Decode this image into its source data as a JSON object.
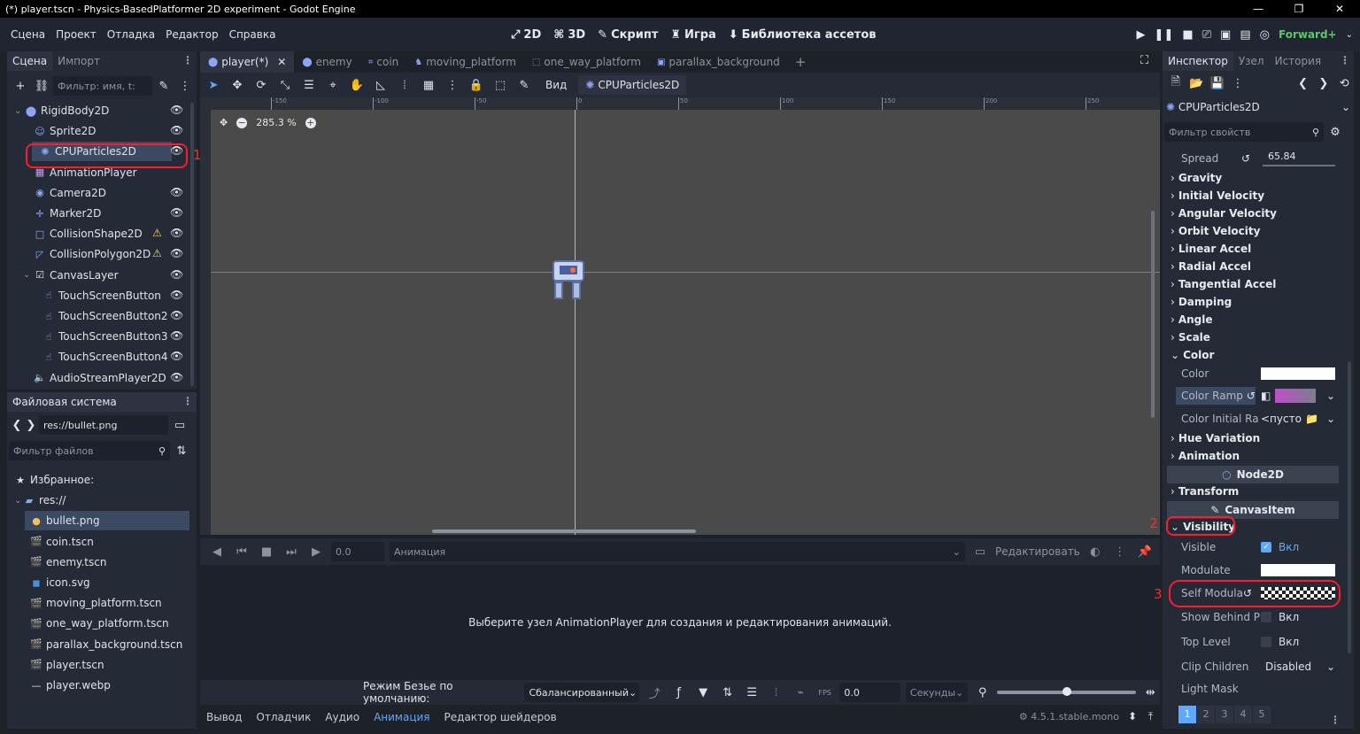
{
  "window": {
    "title": "(*) player.tscn - Physics-BasedPlatformer 2D experiment - Godot Engine",
    "buttons": [
      "—",
      "❐",
      "✕"
    ]
  },
  "menu": [
    "Сцена",
    "Проект",
    "Отладка",
    "Редактор",
    "Справка"
  ],
  "workspaces": [
    {
      "icon": "⤢",
      "label": "2D"
    },
    {
      "icon": "⌘",
      "label": "3D"
    },
    {
      "icon": "✎",
      "label": "Скрипт"
    },
    {
      "icon": "♜",
      "label": "Игра"
    },
    {
      "icon": "⬇",
      "label": "Библиотека ассетов"
    }
  ],
  "renderer": "Forward+",
  "scene_dock": {
    "tabs": [
      "Сцена",
      "Импорт"
    ],
    "filter_placeholder": "Фильтр: имя, t:",
    "nodes": [
      {
        "name": "RigidBody2D",
        "icon": "⬤",
        "color": "#8da5f3",
        "indent": 0,
        "arrow": "⌄"
      },
      {
        "name": "Sprite2D",
        "icon": "☺",
        "color": "#8da5f3",
        "indent": 1,
        "arrow": ""
      },
      {
        "name": "CPUParticles2D",
        "icon": "✺",
        "color": "#8da5f3",
        "indent": 2,
        "arrow": "",
        "selected": true
      },
      {
        "name": "AnimationPlayer",
        "icon": "▦",
        "color": "#c79bff",
        "indent": 1,
        "arrow": "",
        "noeye": true
      },
      {
        "name": "Camera2D",
        "icon": "◉",
        "color": "#8da5f3",
        "indent": 1,
        "arrow": ""
      },
      {
        "name": "Marker2D",
        "icon": "✛",
        "color": "#8da5f3",
        "indent": 1,
        "arrow": ""
      },
      {
        "name": "CollisionShape2D",
        "icon": "□",
        "color": "#8da5f3",
        "indent": 1,
        "arrow": "",
        "warn": true
      },
      {
        "name": "CollisionPolygon2D",
        "icon": "◸",
        "color": "#8da5f3",
        "indent": 1,
        "arrow": "",
        "warn": true
      },
      {
        "name": "CanvasLayer",
        "icon": "☑",
        "color": "#e0e0e0",
        "indent": 1,
        "arrow": "⌄"
      },
      {
        "name": "TouchScreenButton",
        "icon": "☝",
        "color": "#8da5f3",
        "indent": 2,
        "arrow": ""
      },
      {
        "name": "TouchScreenButton2",
        "icon": "☝",
        "color": "#8da5f3",
        "indent": 2,
        "arrow": ""
      },
      {
        "name": "TouchScreenButton3",
        "icon": "☝",
        "color": "#8da5f3",
        "indent": 2,
        "arrow": ""
      },
      {
        "name": "TouchScreenButton4",
        "icon": "☝",
        "color": "#8da5f3",
        "indent": 2,
        "arrow": ""
      },
      {
        "name": "AudioStreamPlayer2D",
        "icon": "🔈",
        "color": "#8da5f3",
        "indent": 1,
        "arrow": ""
      }
    ]
  },
  "fs_dock": {
    "title": "Файловая система",
    "path": "res://bullet.png",
    "filter_placeholder": "Фильтр файлов",
    "items": [
      {
        "name": "Избранное:",
        "icon": "★",
        "color": "#e0e0e0",
        "indent": 0
      },
      {
        "name": "res://",
        "icon": "▰",
        "color": "#7faee8",
        "indent": 0,
        "arrow": "⌄"
      },
      {
        "name": "bullet.png",
        "icon": "●",
        "color": "#f2c35a",
        "indent": 1,
        "selected": true
      },
      {
        "name": "coin.tscn",
        "icon": "🎬",
        "color": "#e0e0e0",
        "indent": 1
      },
      {
        "name": "enemy.tscn",
        "icon": "🎬",
        "color": "#e0e0e0",
        "indent": 1
      },
      {
        "name": "icon.svg",
        "icon": "◼",
        "color": "#4a90d9",
        "indent": 1
      },
      {
        "name": "moving_platform.tscn",
        "icon": "🎬",
        "color": "#e0e0e0",
        "indent": 1
      },
      {
        "name": "one_way_platform.tscn",
        "icon": "🎬",
        "color": "#e0e0e0",
        "indent": 1
      },
      {
        "name": "parallax_background.tscn",
        "icon": "🎬",
        "color": "#e0e0e0",
        "indent": 1
      },
      {
        "name": "player.tscn",
        "icon": "🎬",
        "color": "#e0e0e0",
        "indent": 1
      },
      {
        "name": "player.webp",
        "icon": "—",
        "color": "#e0e0e0",
        "indent": 1
      }
    ]
  },
  "scene_tabs": [
    "player(*)",
    "enemy",
    "coin",
    "moving_platform",
    "one_way_platform",
    "parallax_background"
  ],
  "toolbar": {
    "view_label": "Вид",
    "node_label": "CPUParticles2D"
  },
  "viewport": {
    "zoom": "285.3 %",
    "ruler_ticks": [
      "-150",
      "-100",
      "-50",
      "0",
      "50",
      "100",
      "150",
      "200",
      "250"
    ]
  },
  "anim": {
    "time": "0.0",
    "anim_placeholder": "Анимация",
    "edit_label": "Редактировать",
    "message": "Выберите узел AnimationPlayer для создания и редактирования анимаций.",
    "bezier_label": "Режим Безье по умолчанию:",
    "bezier_value": "Сбалансированный",
    "snap": "0.0",
    "unit": "Секунды"
  },
  "bottom_tabs": [
    "Вывод",
    "Отладчик",
    "Аудио",
    "Анимация",
    "Редактор шейдеров"
  ],
  "version": "4.5.1.stable.mono",
  "inspector": {
    "tabs": [
      "Инспектор",
      "Узел",
      "История"
    ],
    "node": "CPUParticles2D",
    "filter_placeholder": "Фильтр свойств",
    "spread_label": "Spread",
    "spread_value": "65.84",
    "sections": [
      "Gravity",
      "Initial Velocity",
      "Angular Velocity",
      "Orbit Velocity",
      "Linear Accel",
      "Radial Accel",
      "Tangential Accel",
      "Damping",
      "Angle",
      "Scale"
    ],
    "color_section": "Color",
    "color_label": "Color",
    "ramp_label": "Color Ramp",
    "initial_label": "Color Initial Ra",
    "initial_value": "<пусто",
    "hue": "Hue Variation",
    "animation": "Animation",
    "node2d": "Node2D",
    "transform": "Transform",
    "canvasitem": "CanvasItem",
    "visibility": "Visibility",
    "visible_label": "Visible",
    "on": "Вкл",
    "modulate_label": "Modulate",
    "self_mod_label": "Self Modula",
    "show_behind_label": "Show Behind P",
    "top_level_label": "Top Level",
    "clip_label": "Clip Children",
    "clip_value": "Disabled",
    "light_mask_label": "Light Mask",
    "layers": [
      "1",
      "2",
      "3",
      "4",
      "5"
    ]
  },
  "annotations": [
    "1",
    "2",
    "3"
  ],
  "colors": {
    "accent": "#5fa8ff",
    "annotation": "#ff1a2e",
    "warning": "#ffd54a"
  }
}
